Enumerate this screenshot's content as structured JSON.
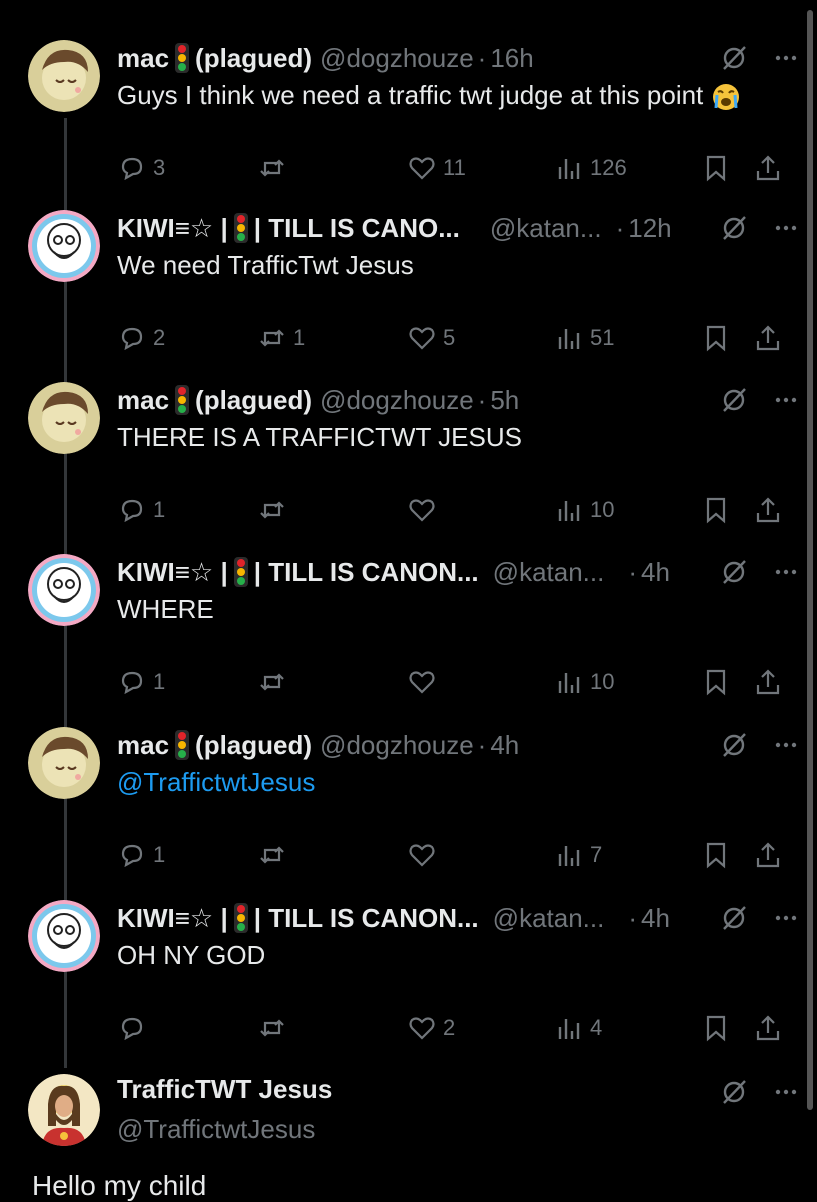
{
  "tweets": [
    {
      "name": "mac",
      "name_suffix": "(plagued)",
      "handle": "@dogzhouze",
      "time": "16h",
      "text": "Guys I think we need a traffic twt judge at this point",
      "replies": "3",
      "reposts": "",
      "likes": "11",
      "views": "126"
    },
    {
      "name": "KIWI≡☆ |",
      "name_suffix": "| TILL IS CANO...",
      "handle": "@katan...",
      "time": "12h",
      "text": "We need TrafficTwt Jesus",
      "replies": "2",
      "reposts": "1",
      "likes": "5",
      "views": "51"
    },
    {
      "name": "mac",
      "name_suffix": "(plagued)",
      "handle": "@dogzhouze",
      "time": "5h",
      "text": "THERE IS A TRAFFICTWT JESUS",
      "replies": "1",
      "reposts": "",
      "likes": "",
      "views": "10"
    },
    {
      "name": "KIWI≡☆ |",
      "name_suffix": "| TILL IS CANON...",
      "handle": "@katan...",
      "time": "4h",
      "text": "WHERE",
      "replies": "1",
      "reposts": "",
      "likes": "",
      "views": "10"
    },
    {
      "name": "mac",
      "name_suffix": "(plagued)",
      "handle": "@dogzhouze",
      "time": "4h",
      "text": "@TraffictwtJesus",
      "replies": "1",
      "reposts": "",
      "likes": "",
      "views": "7"
    },
    {
      "name": "KIWI≡☆ |",
      "name_suffix": "| TILL IS CANON...",
      "handle": "@katan...",
      "time": "4h",
      "text": "OH NY GOD",
      "replies": "",
      "reposts": "",
      "likes": "2",
      "views": "4"
    }
  ],
  "main_tweet": {
    "name": "TrafficTWT Jesus",
    "handle": "@TraffictwtJesus",
    "text": "Hello my child"
  },
  "separator": "·",
  "colors": {
    "background": "#000000",
    "text": "#e7e9ea",
    "muted": "#71767b",
    "link": "#1d9bf0"
  },
  "icons": [
    "reply-icon",
    "repost-icon",
    "like-icon",
    "views-icon",
    "bookmark-icon",
    "share-icon",
    "grok-icon",
    "more-icon",
    "traffic-light-icon",
    "crying-emoji-icon"
  ]
}
